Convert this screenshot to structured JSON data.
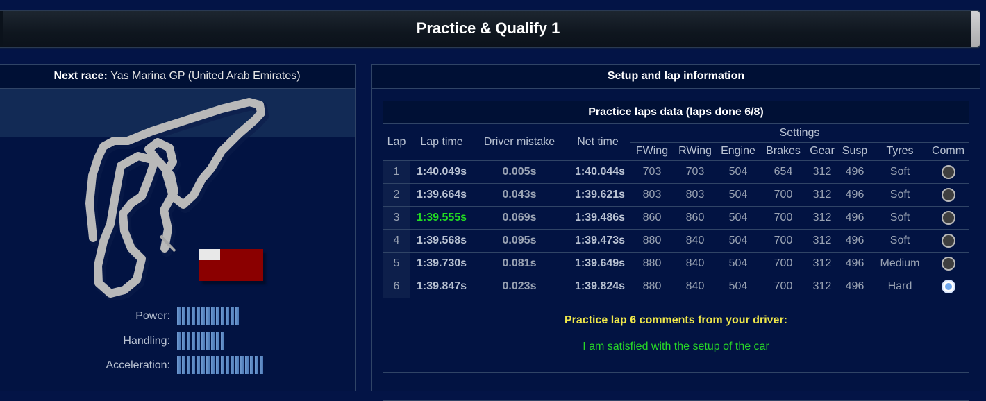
{
  "page": {
    "title": "Practice & Qualify 1"
  },
  "next_race": {
    "label": "Next race:",
    "value": "Yas Marina GP (United Arab Emirates)"
  },
  "car_stats": [
    {
      "label": "Power:",
      "level": 13
    },
    {
      "label": "Handling:",
      "level": 10
    },
    {
      "label": "Acceleration:",
      "level": 18
    }
  ],
  "setup_panel": {
    "title": "Setup and lap information",
    "laps_title": "Practice laps data (laps done 6/8)",
    "headers": {
      "lap": "Lap",
      "lap_time": "Lap time",
      "driver_mistake": "Driver mistake",
      "net_time": "Net time",
      "settings": "Settings",
      "fwing": "FWing",
      "rwing": "RWing",
      "engine": "Engine",
      "brakes": "Brakes",
      "gear": "Gear",
      "susp": "Susp",
      "tyres": "Tyres",
      "comm": "Comm"
    },
    "rows": [
      {
        "lap": "1",
        "lap_time": "1:40.049s",
        "mistake": "0.005s",
        "net": "1:40.044s",
        "fwing": "703",
        "rwing": "703",
        "engine": "504",
        "brakes": "654",
        "gear": "312",
        "susp": "496",
        "tyres": "Soft"
      },
      {
        "lap": "2",
        "lap_time": "1:39.664s",
        "mistake": "0.043s",
        "net": "1:39.621s",
        "fwing": "803",
        "rwing": "803",
        "engine": "504",
        "brakes": "700",
        "gear": "312",
        "susp": "496",
        "tyres": "Soft"
      },
      {
        "lap": "3",
        "lap_time": "1:39.555s",
        "mistake": "0.069s",
        "net": "1:39.486s",
        "fwing": "860",
        "rwing": "860",
        "engine": "504",
        "brakes": "700",
        "gear": "312",
        "susp": "496",
        "tyres": "Soft"
      },
      {
        "lap": "4",
        "lap_time": "1:39.568s",
        "mistake": "0.095s",
        "net": "1:39.473s",
        "fwing": "880",
        "rwing": "840",
        "engine": "504",
        "brakes": "700",
        "gear": "312",
        "susp": "496",
        "tyres": "Soft"
      },
      {
        "lap": "5",
        "lap_time": "1:39.730s",
        "mistake": "0.081s",
        "net": "1:39.649s",
        "fwing": "880",
        "rwing": "840",
        "engine": "504",
        "brakes": "700",
        "gear": "312",
        "susp": "496",
        "tyres": "Medium"
      },
      {
        "lap": "6",
        "lap_time": "1:39.847s",
        "mistake": "0.023s",
        "net": "1:39.824s",
        "fwing": "880",
        "rwing": "840",
        "engine": "504",
        "brakes": "700",
        "gear": "312",
        "susp": "496",
        "tyres": "Hard"
      }
    ],
    "highlights": {
      "best_lap_time_row": 2,
      "best_mistake_row": 0,
      "best_net_row": 3
    },
    "selected_comment_row": 5,
    "comment_title": "Practice lap 6 comments from your driver:",
    "comment_text": "I am satisfied with the setup of the car"
  },
  "colors": {
    "background": "#031446",
    "highlight": "#22dd22",
    "comment_title": "#f0e84a"
  }
}
